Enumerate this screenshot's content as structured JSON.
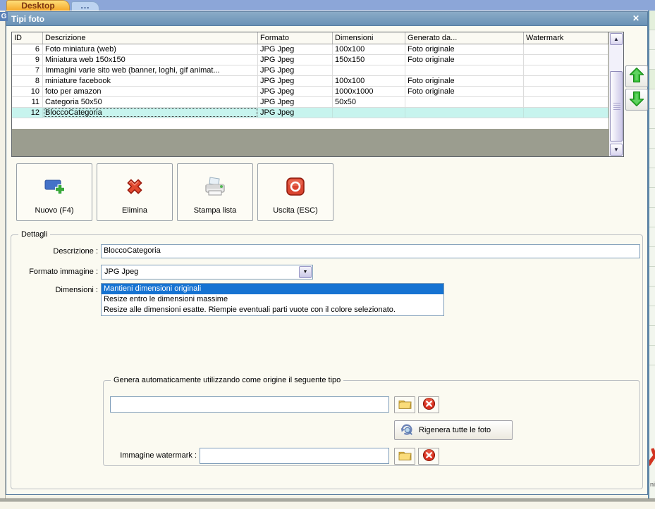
{
  "tabs": {
    "desktop": "Desktop",
    "more": "..."
  },
  "sidebar": {
    "g_label": "G"
  },
  "background": {
    "fragment": "ni"
  },
  "dialog": {
    "title": "Tipi foto",
    "close_glyph": "✕"
  },
  "icons": {
    "scroll_up": "▲",
    "scroll_down": "▼",
    "combo_arrow": "▼"
  },
  "table": {
    "columns": [
      "ID",
      "Descrizione",
      "Formato",
      "Dimensioni",
      "Generato da...",
      "Watermark"
    ],
    "rows": [
      {
        "id": "6",
        "descrizione": "Foto miniatura (web)",
        "formato": "JPG Jpeg",
        "dimensioni": "100x100",
        "generato": "Foto originale",
        "watermark": "",
        "selected": false
      },
      {
        "id": "9",
        "descrizione": "Miniatura web 150x150",
        "formato": "JPG Jpeg",
        "dimensioni": "150x150",
        "generato": "Foto originale",
        "watermark": "",
        "selected": false
      },
      {
        "id": "7",
        "descrizione": "Immagini varie sito web (banner, loghi, gif animat...",
        "formato": "JPG Jpeg",
        "dimensioni": "",
        "generato": "",
        "watermark": "",
        "selected": false
      },
      {
        "id": "8",
        "descrizione": "miniature facebook",
        "formato": "JPG Jpeg",
        "dimensioni": "100x100",
        "generato": "Foto originale",
        "watermark": "",
        "selected": false
      },
      {
        "id": "10",
        "descrizione": "foto per amazon",
        "formato": "JPG Jpeg",
        "dimensioni": "1000x1000",
        "generato": "Foto originale",
        "watermark": "",
        "selected": false
      },
      {
        "id": "11",
        "descrizione": "Categoria 50x50",
        "formato": "JPG Jpeg",
        "dimensioni": "50x50",
        "generato": "",
        "watermark": "",
        "selected": false
      },
      {
        "id": "12",
        "descrizione": "BloccoCategoria",
        "formato": "JPG Jpeg",
        "dimensioni": "",
        "generato": "",
        "watermark": "",
        "selected": true
      }
    ]
  },
  "toolbar": {
    "nuovo": "Nuovo (F4)",
    "elimina": "Elimina",
    "stampa": "Stampa lista",
    "uscita": "Uscita (ESC)"
  },
  "dettagli": {
    "legend": "Dettagli",
    "descrizione_label": "Descrizione :",
    "descrizione_value": "BloccoCategoria",
    "formato_label": "Formato immagine :",
    "formato_value": "JPG Jpeg",
    "dimensioni_label": "Dimensioni :",
    "dimensioni_options": [
      "Mantieni dimensioni originali",
      "Resize entro le dimensioni massime",
      "Resize alle dimensioni esatte. Riempie eventuali parti vuote con il colore selezionato."
    ],
    "dimensioni_selected_index": 0
  },
  "genera": {
    "legend": "Genera automaticamente utilizzando come origine il seguente tipo",
    "origine_value": "",
    "rigenera_label": "Rigenera tutte le foto",
    "watermark_label": "Immagine watermark :",
    "watermark_value": ""
  },
  "colors": {
    "selected_row": "#c7f4ee",
    "list_selection": "#1673d2",
    "active_tab": "#f6a92a",
    "titlebar": "#6a92b6"
  }
}
